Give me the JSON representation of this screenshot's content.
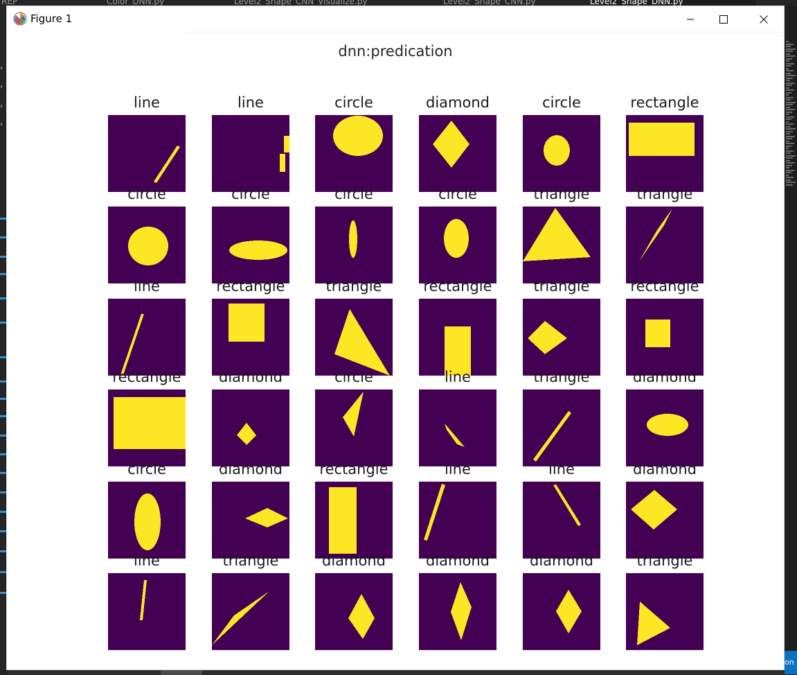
{
  "editor_tabs": [
    {
      "label": "REP"
    },
    {
      "label": "_Color_DNN.py"
    },
    {
      "label": "Level2_Shape_CNN_Visualize.py"
    },
    {
      "label": "Level2_Shape_CNN.py"
    },
    {
      "label": "Level2_Shape_DNN.py",
      "active": true
    }
  ],
  "window": {
    "title": "Figure 1",
    "icon": "matplotlib-logo-icon",
    "controls": [
      "minimize-icon",
      "maximize-icon",
      "close-icon"
    ]
  },
  "figure": {
    "suptitle": "dnn:predication",
    "image_colors": {
      "background": "#440154",
      "shape": "#fde725"
    },
    "subplots": [
      {
        "title": "line",
        "shape": "line"
      },
      {
        "title": "line",
        "shape": "line"
      },
      {
        "title": "circle",
        "shape": "ellipse"
      },
      {
        "title": "diamond",
        "shape": "diamond"
      },
      {
        "title": "circle",
        "shape": "circle"
      },
      {
        "title": "rectangle",
        "shape": "rectangle"
      },
      {
        "title": "circle",
        "shape": "circle"
      },
      {
        "title": "circle",
        "shape": "ellipse"
      },
      {
        "title": "circle",
        "shape": "ellipse"
      },
      {
        "title": "circle",
        "shape": "ellipse"
      },
      {
        "title": "triangle",
        "shape": "triangle"
      },
      {
        "title": "triangle",
        "shape": "triangle"
      },
      {
        "title": "line",
        "shape": "line"
      },
      {
        "title": "rectangle",
        "shape": "rectangle"
      },
      {
        "title": "triangle",
        "shape": "triangle"
      },
      {
        "title": "rectangle",
        "shape": "rectangle"
      },
      {
        "title": "triangle",
        "shape": "diamond"
      },
      {
        "title": "rectangle",
        "shape": "rectangle"
      },
      {
        "title": "rectangle",
        "shape": "rectangle"
      },
      {
        "title": "diamond",
        "shape": "diamond"
      },
      {
        "title": "circle",
        "shape": "triangle"
      },
      {
        "title": "line",
        "shape": "triangle"
      },
      {
        "title": "triangle",
        "shape": "line"
      },
      {
        "title": "diamond",
        "shape": "ellipse"
      },
      {
        "title": "circle",
        "shape": "ellipse"
      },
      {
        "title": "diamond",
        "shape": "diamond"
      },
      {
        "title": "rectangle",
        "shape": "rectangle"
      },
      {
        "title": "line",
        "shape": "line"
      },
      {
        "title": "line",
        "shape": "line"
      },
      {
        "title": "diamond",
        "shape": "diamond"
      },
      {
        "title": "line",
        "shape": "line"
      },
      {
        "title": "triangle",
        "shape": "triangle"
      },
      {
        "title": "diamond",
        "shape": "diamond"
      },
      {
        "title": "diamond",
        "shape": "diamond"
      },
      {
        "title": "diamond",
        "shape": "diamond"
      },
      {
        "title": "triangle",
        "shape": "triangle"
      }
    ]
  },
  "status_button": {
    "label": "on"
  }
}
